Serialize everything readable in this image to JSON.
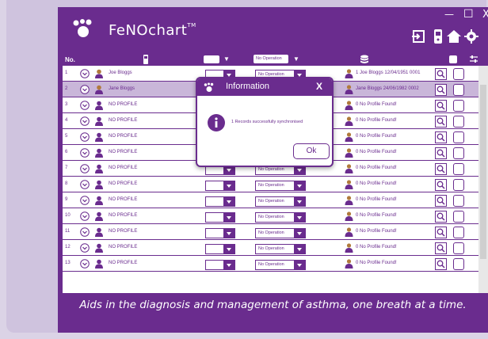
{
  "app": {
    "name": "FeNOchart",
    "trademark": "TM"
  },
  "window_controls": {
    "minimize": "—",
    "maximize": "☐",
    "close": "X"
  },
  "header_icons": [
    "exit-icon",
    "device-icon",
    "home-icon",
    "settings-icon"
  ],
  "table": {
    "headers": {
      "no": "No.",
      "operation": "No Operation"
    },
    "rows": [
      {
        "no": "1",
        "name": "Joe Bloggs",
        "operation": "No Operation",
        "result": "1 Joe Bloggs 12/04/1951 0001",
        "profile": true
      },
      {
        "no": "2",
        "name": "Jane Bloggs",
        "operation": "No Operation",
        "result": "Jane Bloggs 24/06/1982 0002",
        "profile": true
      },
      {
        "no": "3",
        "name": "NO PROFILE",
        "operation": "No Operation",
        "result": "0 No Profile Found!"
      },
      {
        "no": "4",
        "name": "NO PROFILE",
        "operation": "No Operation",
        "result": "0 No Profile Found!"
      },
      {
        "no": "5",
        "name": "NO PROFILE",
        "operation": "No Operation",
        "result": "0 No Profile Found!"
      },
      {
        "no": "6",
        "name": "NO PROFILE",
        "operation": "No Operation",
        "result": "0 No Profile Found!"
      },
      {
        "no": "7",
        "name": "NO PROFILE",
        "operation": "No Operation",
        "result": "0 No Profile Found!"
      },
      {
        "no": "8",
        "name": "NO PROFILE",
        "operation": "No Operation",
        "result": "0 No Profile Found!"
      },
      {
        "no": "9",
        "name": "NO PROFILE",
        "operation": "No Operation",
        "result": "0 No Profile Found!"
      },
      {
        "no": "10",
        "name": "NO PROFILE",
        "operation": "No Operation",
        "result": "0 No Profile Found!"
      },
      {
        "no": "11",
        "name": "NO PROFILE",
        "operation": "No Operation",
        "result": "0 No Profile Found!"
      },
      {
        "no": "12",
        "name": "NO PROFILE",
        "operation": "No Operation",
        "result": "0 No Profile Found!"
      },
      {
        "no": "13",
        "name": "NO PROFILE",
        "operation": "No Operation",
        "result": "0 No Profile Found!"
      }
    ],
    "selected_row": 1
  },
  "modal": {
    "title": "Information",
    "close": "X",
    "message": "1 Records successfully synchronised",
    "ok_label": "Ok"
  },
  "caption": "Aids in the diagnosis and management of asthma, one breath at a time.",
  "colors": {
    "brand": "#6a2c8e",
    "selected_row": "#c9b6d9",
    "background": "#cfc3de"
  }
}
